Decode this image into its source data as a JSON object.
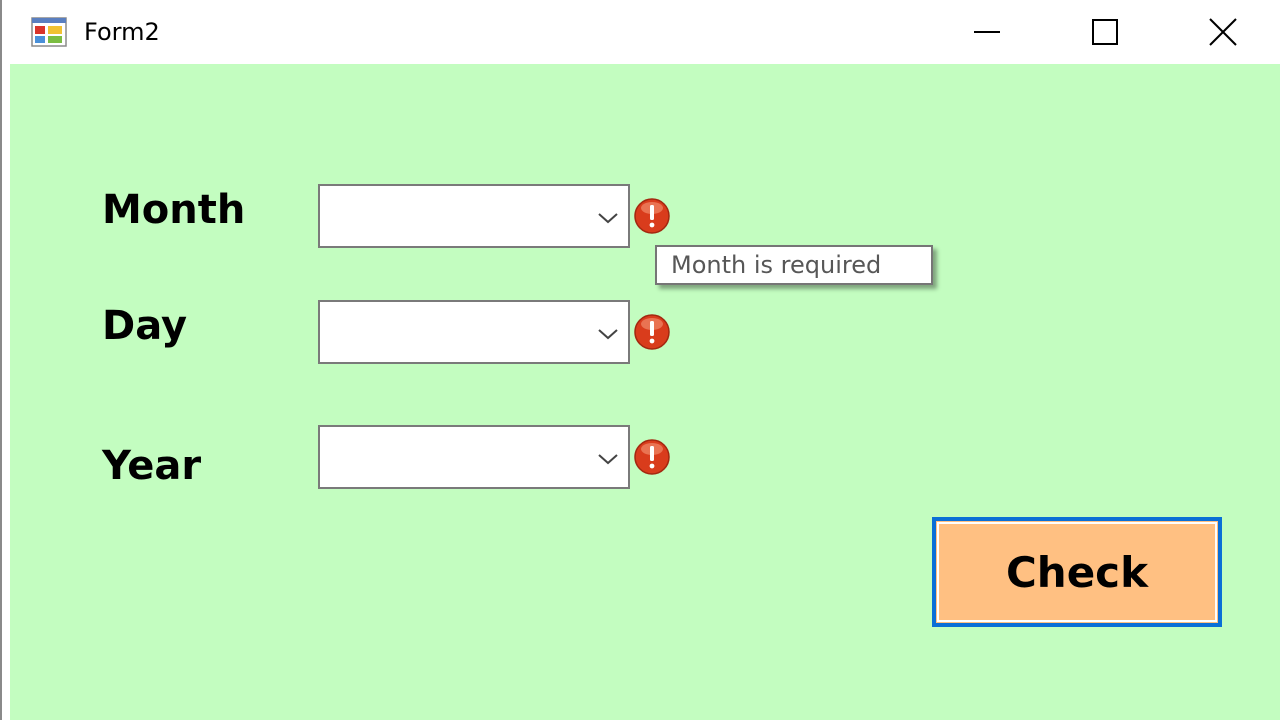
{
  "window": {
    "title": "Form2",
    "app_icon": "winforms-app-icon",
    "controls": {
      "minimize_icon": "minimize-icon",
      "maximize_icon": "maximize-icon",
      "close_icon": "close-icon"
    }
  },
  "form": {
    "background_color": "#c3fdc0",
    "fields": [
      {
        "label": "Month",
        "value": "",
        "error_icon": "error-icon"
      },
      {
        "label": "Day",
        "value": "",
        "error_icon": "error-icon"
      },
      {
        "label": "Year",
        "value": "",
        "error_icon": "error-icon"
      }
    ],
    "tooltip": "Month is required",
    "check_button": {
      "label": "Check",
      "background_color": "#ffc082",
      "border_color": "#0a6fd6"
    }
  }
}
